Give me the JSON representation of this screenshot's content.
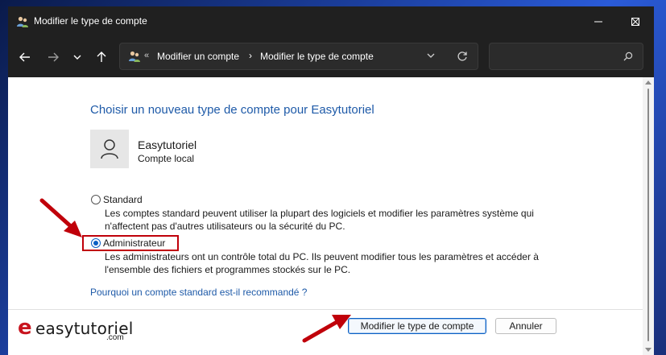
{
  "window": {
    "title": "Modifier le type de compte",
    "controls": [
      "minimize",
      "maximize",
      "close"
    ]
  },
  "navbar": {
    "breadcrumb_sep0": "«",
    "breadcrumb_1": "Modifier un compte",
    "breadcrumb_sep1": "›",
    "breadcrumb_2": "Modifier le type de compte",
    "search_placeholder": ""
  },
  "main": {
    "heading": "Choisir un nouveau type de compte pour Easytutoriel",
    "user": {
      "name": "Easytutoriel",
      "type": "Compte local"
    },
    "options": [
      {
        "label": "Standard",
        "selected": false,
        "desc_line1": "Les comptes standard peuvent utiliser la plupart des logiciels et modifier les paramètres système qui",
        "desc_line2": "n'affectent pas d'autres utilisateurs ou la sécurité du PC."
      },
      {
        "label": "Administrateur",
        "selected": true,
        "desc_line1": "Les administrateurs ont un contrôle total du PC. Ils peuvent modifier tous les paramètres et accéder à",
        "desc_line2": "l'ensemble des fichiers et programmes stockés sur le PC."
      }
    ],
    "help_link": "Pourquoi un compte standard est-il recommandé ?"
  },
  "footer": {
    "primary_button": "Modifier le type de compte",
    "cancel_button": "Annuler",
    "logo_e": "e",
    "logo_text": "easytutoriel",
    "logo_domain": ".com"
  },
  "colors": {
    "heading": "#1e5aa8",
    "annotation": "#c0000a",
    "accent": "#0a5fc4"
  }
}
